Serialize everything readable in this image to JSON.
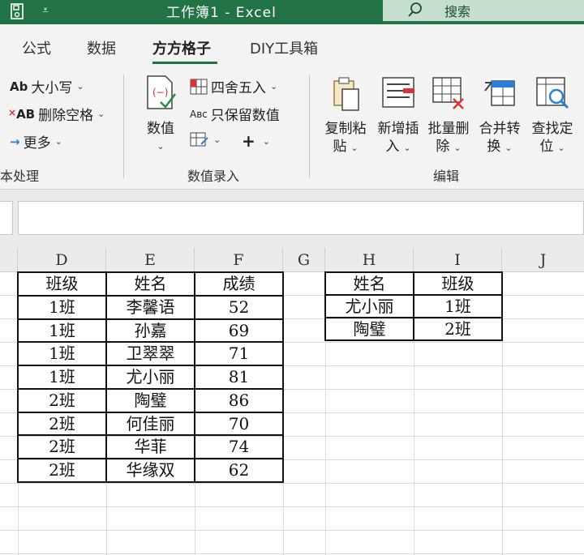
{
  "titlebar": {
    "title": "工作簿1  -  Excel",
    "search_label": "搜索"
  },
  "ribbon": {
    "tabs": [
      {
        "label": "公式",
        "active": false
      },
      {
        "label": "数据",
        "active": false
      },
      {
        "label": "方方格子",
        "active": true
      },
      {
        "label": "DIY工具箱",
        "active": false
      }
    ],
    "text_group": {
      "size_case": "大小写",
      "delete_spaces": "删除空格",
      "more": "更多",
      "label": "本处理"
    },
    "number_group": {
      "value_line1": "数值",
      "round": "四舍五入",
      "keep_values": "只保留数值",
      "label": "数值录入"
    },
    "edit_group": {
      "buttons": [
        {
          "line1": "复制粘",
          "line2": "贴"
        },
        {
          "line1": "新增插",
          "line2": "入"
        },
        {
          "line1": "批量删",
          "line2": "除"
        },
        {
          "line1": "合并转",
          "line2": "换"
        },
        {
          "line1": "查找定",
          "line2": "位"
        }
      ],
      "label": "编辑"
    }
  },
  "grid": {
    "columns": [
      "D",
      "E",
      "F",
      "G",
      "H",
      "I",
      "J"
    ],
    "table1": {
      "headers": [
        "班级",
        "姓名",
        "成绩"
      ],
      "rows": [
        [
          "1班",
          "李馨语",
          "52"
        ],
        [
          "1班",
          "孙嘉",
          "69"
        ],
        [
          "1班",
          "卫翠翠",
          "71"
        ],
        [
          "1班",
          "尤小丽",
          "81"
        ],
        [
          "2班",
          "陶璧",
          "86"
        ],
        [
          "2班",
          "何佳丽",
          "70"
        ],
        [
          "2班",
          "华菲",
          "74"
        ],
        [
          "2班",
          "华缘双",
          "62"
        ]
      ]
    },
    "table2": {
      "headers": [
        "姓名",
        "班级"
      ],
      "rows": [
        [
          "尤小丽",
          "1班"
        ],
        [
          "陶璧",
          "2班"
        ]
      ]
    }
  }
}
